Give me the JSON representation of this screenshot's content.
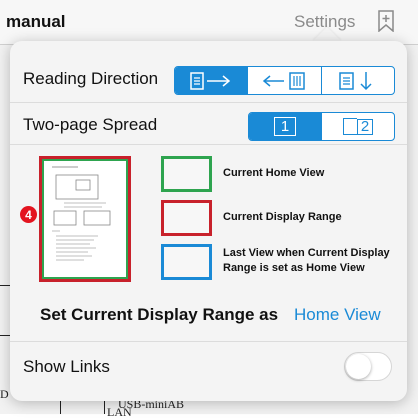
{
  "topbar": {
    "title": "manual",
    "settings_label": "Settings",
    "bookmark_icon": "bookmark-plus-icon"
  },
  "background_doc": {
    "text_bottom": "USB-miniAB",
    "text_lan": "LAN",
    "text_left": "D"
  },
  "popover": {
    "reading_direction": {
      "label": "Reading Direction",
      "options": [
        "page-right-icon",
        "page-left-icon",
        "page-down-icon"
      ],
      "selected": 0
    },
    "two_page_spread": {
      "label": "Two-page Spread",
      "options": [
        "1",
        "2"
      ],
      "selected": 0
    },
    "legend": {
      "badge": "4",
      "home_view": "Current Home View",
      "display_range": "Current Display Range",
      "last_view_line1": "Last View when Current Display",
      "last_view_line2": "Range is set as Home View",
      "colors": {
        "home": "#2ea44f",
        "display": "#c8212b",
        "last": "#1a8ad6"
      }
    },
    "set_range_label": "Set Current Display Range as",
    "home_view_link": "Home View",
    "show_links": {
      "label": "Show Links",
      "on": false
    }
  },
  "colors": {
    "accent": "#1a8ad6",
    "badge": "#e3141f"
  }
}
